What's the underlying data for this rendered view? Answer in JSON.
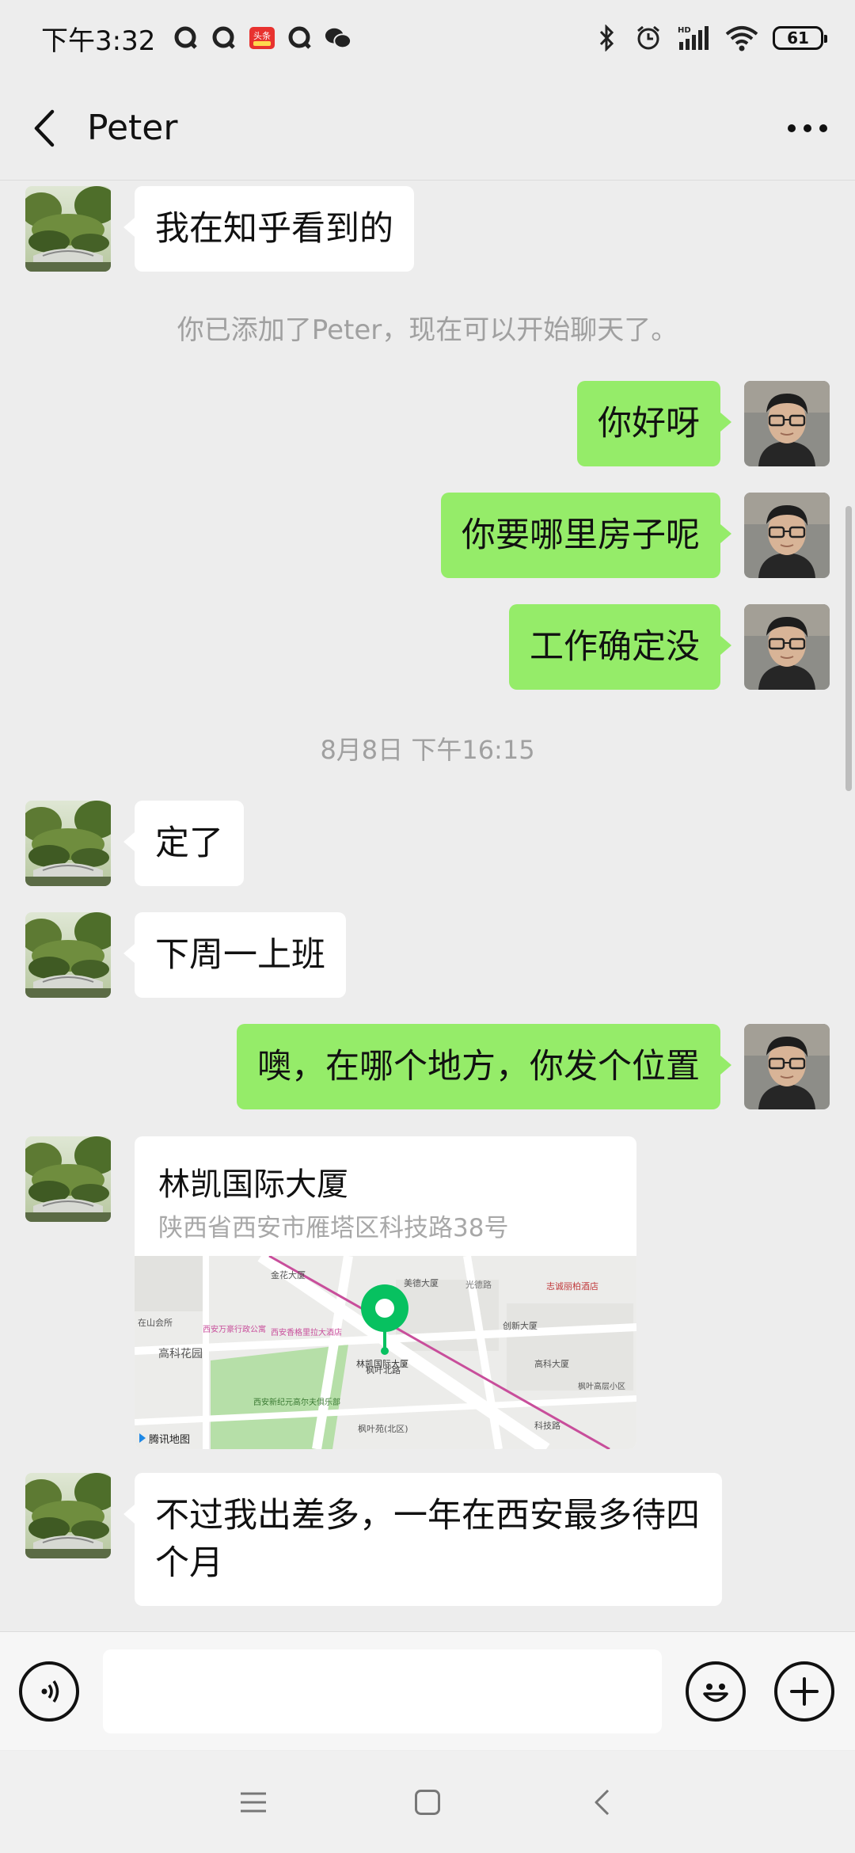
{
  "status_bar": {
    "time": "下午3:32",
    "toutiao_label": "头条",
    "battery": "61",
    "hd_label": "HD"
  },
  "header": {
    "title": "Peter"
  },
  "messages": [
    {
      "id": "m1",
      "side": "in",
      "text": "我在知乎看到的"
    },
    {
      "id": "note1",
      "type": "system",
      "text": "你已添加了Peter，现在可以开始聊天了。"
    },
    {
      "id": "m2",
      "side": "out",
      "text": "你好呀"
    },
    {
      "id": "m3",
      "side": "out",
      "text": "你要哪里房子呢"
    },
    {
      "id": "m4",
      "side": "out",
      "text": "工作确定没"
    },
    {
      "id": "ts1",
      "type": "time",
      "text": "8月8日 下午16:15"
    },
    {
      "id": "m5",
      "side": "in",
      "text": "定了"
    },
    {
      "id": "m6",
      "side": "in",
      "text": "下周一上班"
    },
    {
      "id": "m7",
      "side": "out",
      "text": "噢，在哪个地方，你发个位置"
    },
    {
      "id": "m8",
      "side": "in",
      "type": "location",
      "name": "林凯国际大厦",
      "address": "陕西省西安市雁塔区科技路38号",
      "map_labels": {
        "pin_label": "林凯国际大厦",
        "provider": "腾讯地图",
        "jinhua": "金花大厦",
        "meide": "美德大厦",
        "guangde": "光德路",
        "zhicheng": "志诚丽柏酒店",
        "chuangxin": "创新大厦",
        "gaoke": "高科大厦",
        "gaokehuayuan": "高科花园",
        "wanda": "西安万豪行政公寓",
        "gelila": "西安香格里拉大酒店",
        "xinjiyuan": "西安新纪元高尔夫俱乐部",
        "fengye": "枫叶北路",
        "fengyeyuan": "枫叶苑(北区)",
        "fengyegaoxin": "枫叶高层小区",
        "kejilu": "科技路",
        "zaishan": "在山会所"
      }
    },
    {
      "id": "m9",
      "side": "in",
      "text": "不过我出差多，一年在西安最多待四个月"
    }
  ],
  "input": {
    "value": "",
    "placeholder": ""
  },
  "colors": {
    "background": "#ededed",
    "out_bubble": "#95ec69",
    "in_bubble": "#ffffff",
    "map_pin": "#07c160"
  }
}
